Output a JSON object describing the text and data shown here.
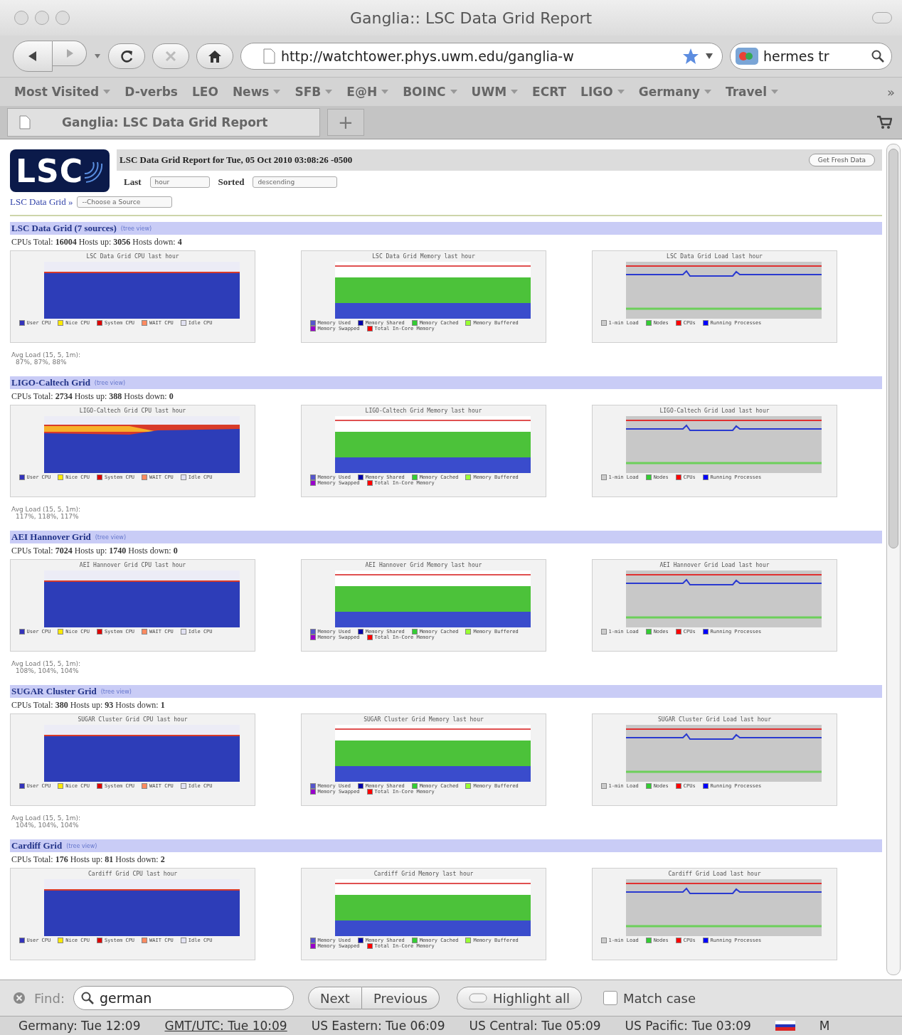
{
  "window": {
    "title": "Ganglia:: LSC Data Grid Report"
  },
  "toolbar": {
    "url": "http://watchtower.phys.uwm.edu/ganglia-w",
    "search": "hermes tr"
  },
  "bookmarks": [
    {
      "label": "Most Visited",
      "menu": true
    },
    {
      "label": "D-verbs",
      "menu": false
    },
    {
      "label": "LEO",
      "menu": false
    },
    {
      "label": "News",
      "menu": true
    },
    {
      "label": "SFB",
      "menu": true
    },
    {
      "label": "E@H",
      "menu": true
    },
    {
      "label": "BOINC",
      "menu": true
    },
    {
      "label": "UWM",
      "menu": true
    },
    {
      "label": "ECRT",
      "menu": false
    },
    {
      "label": "LIGO",
      "menu": true
    },
    {
      "label": "Germany",
      "menu": true
    },
    {
      "label": "Travel",
      "menu": true
    }
  ],
  "bookmarks_overflow": "»",
  "tabs": [
    {
      "label": "Ganglia: LSC Data Grid Report",
      "selected": true
    }
  ],
  "new_tab": "+",
  "page": {
    "logo": "LSC",
    "report_title": "LSC Data Grid Report for Tue, 05 Oct 2010 03:08:26 -0500",
    "refresh_button": "Get Fresh Data",
    "last_label": "Last",
    "last_value": "hour",
    "sorted_label": "Sorted",
    "sorted_value": "descending",
    "breadcrumb": "LSC Data Grid »",
    "source_value": "--Choose a Source"
  },
  "sections": [
    {
      "title": "LSC Data Grid (7 sources)",
      "link": "(tree view)",
      "stats": "CPUs Total: **16004** Hosts up: **3056** Hosts down: **4**",
      "avg_load_label": "Avg Load (15, 5, 1m):",
      "avg_load": "87%, 87%, 88%",
      "graphs": [
        {
          "kind": "cpu",
          "title": "LSC Data Grid CPU last hour",
          "legend": [
            {
              "label": "User CPU",
              "color": "#3333bb"
            },
            {
              "label": "Nice CPU",
              "color": "#ffea00"
            },
            {
              "label": "System CPU",
              "color": "#dd0000"
            },
            {
              "label": "WAIT CPU",
              "color": "#ff8a60"
            },
            {
              "label": "Idle CPU",
              "color": "#e2e2f2"
            }
          ]
        },
        {
          "kind": "memory",
          "title": "LSC Data Grid Memory last hour",
          "legend": [
            {
              "label": "Memory Used",
              "color": "#5555cc"
            },
            {
              "label": "Memory Shared",
              "color": "#0000aa"
            },
            {
              "label": "Memory Cached",
              "color": "#33cc33"
            },
            {
              "label": "Memory Buffered",
              "color": "#99ff33"
            },
            {
              "label": "Memory Swapped",
              "color": "#9900cc"
            },
            {
              "label": "Total In-Core Memory",
              "color": "#ff0000"
            }
          ]
        },
        {
          "kind": "load",
          "title": "LSC Data Grid Load last hour",
          "legend": [
            {
              "label": "1-min Load",
              "color": "#cccccc"
            },
            {
              "label": "Nodes",
              "color": "#33cc33"
            },
            {
              "label": "CPUs",
              "color": "#ff0000"
            },
            {
              "label": "Running Processes",
              "color": "#0000ff"
            }
          ]
        }
      ]
    },
    {
      "title": "LIGO-Caltech Grid",
      "link": "(tree view)",
      "stats": "CPUs Total: **2734** Hosts up: **388** Hosts down: **0**",
      "avg_load_label": "Avg Load (15, 5, 1m):",
      "avg_load": "117%, 118%, 117%",
      "graphs": [
        {
          "kind": "cpu",
          "title": "LIGO-Caltech Grid CPU last hour",
          "legend": [
            {
              "label": "User CPU",
              "color": "#3333bb"
            },
            {
              "label": "Nice CPU",
              "color": "#ffea00"
            },
            {
              "label": "System CPU",
              "color": "#dd0000"
            },
            {
              "label": "WAIT CPU",
              "color": "#ff8a60"
            },
            {
              "label": "Idle CPU",
              "color": "#e2e2f2"
            }
          ]
        },
        {
          "kind": "memory",
          "title": "LIGO-Caltech Grid Memory last hour",
          "legend": [
            {
              "label": "Memory Used",
              "color": "#5555cc"
            },
            {
              "label": "Memory Shared",
              "color": "#0000aa"
            },
            {
              "label": "Memory Cached",
              "color": "#33cc33"
            },
            {
              "label": "Memory Buffered",
              "color": "#99ff33"
            },
            {
              "label": "Memory Swapped",
              "color": "#9900cc"
            },
            {
              "label": "Total In-Core Memory",
              "color": "#ff0000"
            }
          ]
        },
        {
          "kind": "load",
          "title": "LIGO-Caltech Grid Load last hour",
          "legend": [
            {
              "label": "1-min Load",
              "color": "#cccccc"
            },
            {
              "label": "Nodes",
              "color": "#33cc33"
            },
            {
              "label": "CPUs",
              "color": "#ff0000"
            },
            {
              "label": "Running Processes",
              "color": "#0000ff"
            }
          ]
        }
      ]
    },
    {
      "title": "AEI Hannover Grid",
      "link": "(tree view)",
      "stats": "CPUs Total: **7024** Hosts up: **1740** Hosts down: **0**",
      "avg_load_label": "Avg Load (15, 5, 1m):",
      "avg_load": "108%, 104%, 104%",
      "graphs": [
        {
          "kind": "cpu",
          "title": "AEI Hannover Grid CPU last hour",
          "legend": [
            {
              "label": "User CPU",
              "color": "#3333bb"
            },
            {
              "label": "Nice CPU",
              "color": "#ffea00"
            },
            {
              "label": "System CPU",
              "color": "#dd0000"
            },
            {
              "label": "WAIT CPU",
              "color": "#ff8a60"
            },
            {
              "label": "Idle CPU",
              "color": "#e2e2f2"
            }
          ]
        },
        {
          "kind": "memory",
          "title": "AEI Hannover Grid Memory last hour",
          "legend": [
            {
              "label": "Memory Used",
              "color": "#5555cc"
            },
            {
              "label": "Memory Shared",
              "color": "#0000aa"
            },
            {
              "label": "Memory Cached",
              "color": "#33cc33"
            },
            {
              "label": "Memory Buffered",
              "color": "#99ff33"
            },
            {
              "label": "Memory Swapped",
              "color": "#9900cc"
            },
            {
              "label": "Total In-Core Memory",
              "color": "#ff0000"
            }
          ]
        },
        {
          "kind": "load",
          "title": "AEI Hannover Grid Load last hour",
          "legend": [
            {
              "label": "1-min Load",
              "color": "#cccccc"
            },
            {
              "label": "Nodes",
              "color": "#33cc33"
            },
            {
              "label": "CPUs",
              "color": "#ff0000"
            },
            {
              "label": "Running Processes",
              "color": "#0000ff"
            }
          ]
        }
      ]
    },
    {
      "title": "SUGAR Cluster Grid",
      "link": "(tree view)",
      "stats": "CPUs Total: **380** Hosts up: **93** Hosts down: **1**",
      "avg_load_label": "Avg Load (15, 5, 1m):",
      "avg_load": "104%, 104%, 104%",
      "graphs": [
        {
          "kind": "cpu",
          "title": "SUGAR Cluster Grid CPU last hour",
          "legend": [
            {
              "label": "User CPU",
              "color": "#3333bb"
            },
            {
              "label": "Nice CPU",
              "color": "#ffea00"
            },
            {
              "label": "System CPU",
              "color": "#dd0000"
            },
            {
              "label": "WAIT CPU",
              "color": "#ff8a60"
            },
            {
              "label": "Idle CPU",
              "color": "#e2e2f2"
            }
          ]
        },
        {
          "kind": "memory",
          "title": "SUGAR Cluster Grid Memory last hour",
          "legend": [
            {
              "label": "Memory Used",
              "color": "#5555cc"
            },
            {
              "label": "Memory Shared",
              "color": "#0000aa"
            },
            {
              "label": "Memory Cached",
              "color": "#33cc33"
            },
            {
              "label": "Memory Buffered",
              "color": "#99ff33"
            },
            {
              "label": "Memory Swapped",
              "color": "#9900cc"
            },
            {
              "label": "Total In-Core Memory",
              "color": "#ff0000"
            }
          ]
        },
        {
          "kind": "load",
          "title": "SUGAR Cluster Grid Load last hour",
          "legend": [
            {
              "label": "1-min Load",
              "color": "#cccccc"
            },
            {
              "label": "Nodes",
              "color": "#33cc33"
            },
            {
              "label": "CPUs",
              "color": "#ff0000"
            },
            {
              "label": "Running Processes",
              "color": "#0000ff"
            }
          ]
        }
      ]
    },
    {
      "title": "Cardiff Grid",
      "link": "(tree view)",
      "stats": "CPUs Total: **176** Hosts up: **81** Hosts down: **2**",
      "graphs": [
        {
          "kind": "cpu",
          "title": "Cardiff Grid CPU last hour",
          "legend": [
            {
              "label": "User CPU",
              "color": "#3333bb"
            },
            {
              "label": "Nice CPU",
              "color": "#ffea00"
            },
            {
              "label": "System CPU",
              "color": "#dd0000"
            },
            {
              "label": "WAIT CPU",
              "color": "#ff8a60"
            },
            {
              "label": "Idle CPU",
              "color": "#e2e2f2"
            }
          ]
        },
        {
          "kind": "memory",
          "title": "Cardiff Grid Memory last hour",
          "legend": [
            {
              "label": "Memory Used",
              "color": "#5555cc"
            },
            {
              "label": "Memory Shared",
              "color": "#0000aa"
            },
            {
              "label": "Memory Cached",
              "color": "#33cc33"
            },
            {
              "label": "Memory Buffered",
              "color": "#99ff33"
            },
            {
              "label": "Memory Swapped",
              "color": "#9900cc"
            },
            {
              "label": "Total In-Core Memory",
              "color": "#ff0000"
            }
          ]
        },
        {
          "kind": "load",
          "title": "Cardiff Grid Load last hour",
          "legend": [
            {
              "label": "1-min Load",
              "color": "#cccccc"
            },
            {
              "label": "Nodes",
              "color": "#33cc33"
            },
            {
              "label": "CPUs",
              "color": "#ff0000"
            },
            {
              "label": "Running Processes",
              "color": "#0000ff"
            }
          ]
        }
      ]
    }
  ],
  "find_bar": {
    "label": "Find:",
    "query": "german",
    "next": "Next",
    "previous": "Previous",
    "highlight": "Highlight all",
    "match_case": {
      "label": "Match case",
      "checked": false
    }
  },
  "status_bar": [
    {
      "text": "Germany: Tue 12:09",
      "underlined": false
    },
    {
      "text": "GMT/UTC: Tue 10:09",
      "underlined": true
    },
    {
      "text": "US Eastern: Tue 06:09",
      "underlined": false
    },
    {
      "text": "US Central: Tue 05:09",
      "underlined": false
    },
    {
      "text": "US Pacific: Tue 03:09",
      "underlined": false
    }
  ],
  "status_extra": "M"
}
